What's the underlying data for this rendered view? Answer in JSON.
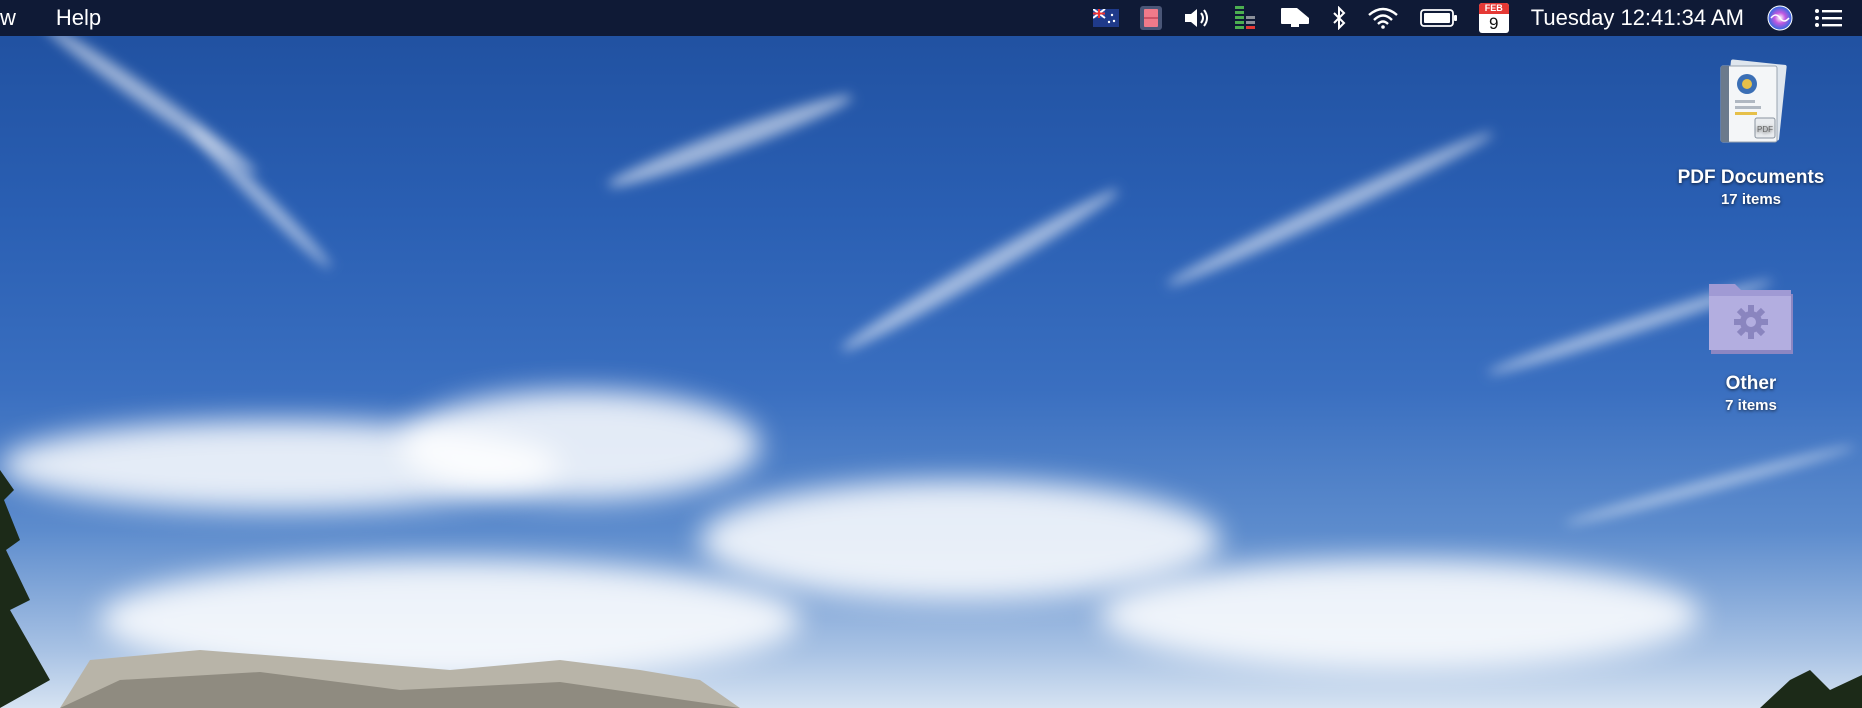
{
  "menubar": {
    "items": [
      {
        "label": "w"
      },
      {
        "label": "Help"
      }
    ],
    "status": {
      "calendar_month": "FEB",
      "calendar_day": "9",
      "clock": "Tuesday 12:41:34 AM"
    },
    "icons": [
      "flag-icon",
      "app-red-icon",
      "volume-icon",
      "memory-meter-icon",
      "display-icon",
      "bluetooth-icon",
      "wifi-icon",
      "battery-icon",
      "calendar-icon",
      "siri-icon",
      "list-icon"
    ]
  },
  "desktop": {
    "items": [
      {
        "name": "PDF Documents",
        "sub": "17 items",
        "icon": "pdf-stack-icon"
      },
      {
        "name": "Other",
        "sub": "7 items",
        "icon": "gear-folder-icon"
      }
    ]
  },
  "colors": {
    "menubar_bg": "#0f1a36",
    "sky_top": "#1f4f9e",
    "sky_bottom": "#d6e3f2"
  }
}
